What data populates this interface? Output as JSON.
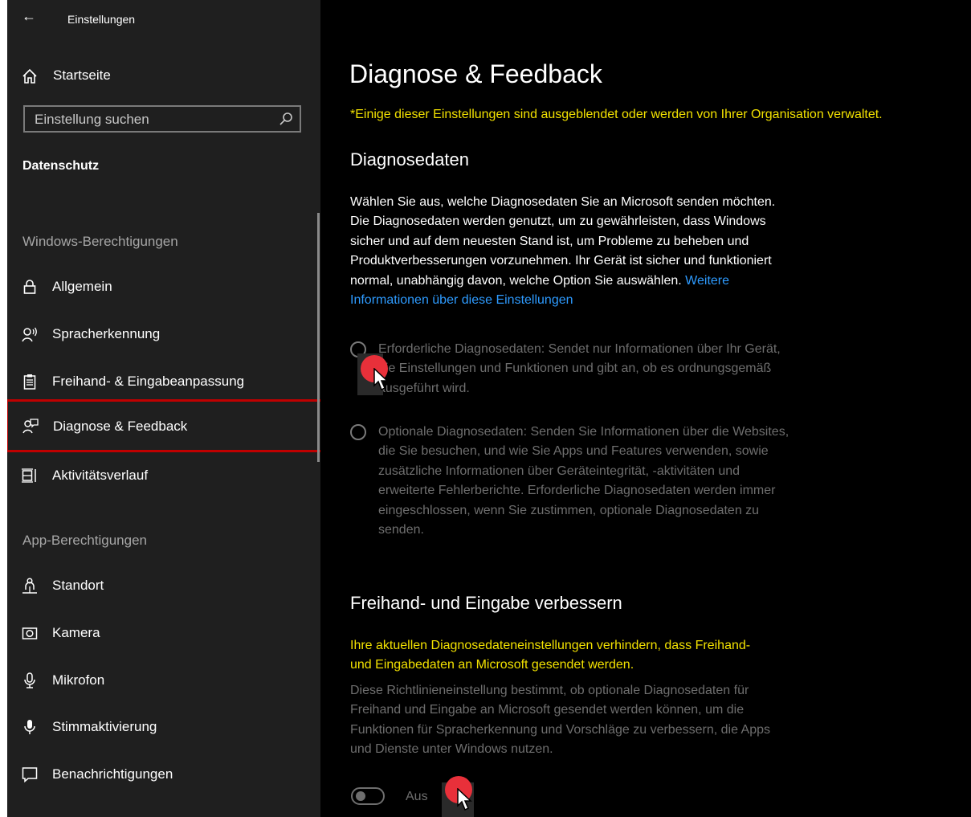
{
  "window": {
    "title": "Einstellungen",
    "back_glyph": "←"
  },
  "sidebar": {
    "home_label": "Startseite",
    "search_placeholder": "Einstellung suchen",
    "section_title": "Datenschutz",
    "group_windows": "Windows-Berechtigungen",
    "group_apps": "App-Berechtigungen",
    "windows_items": [
      {
        "label": "Allgemein",
        "icon": "lock-icon"
      },
      {
        "label": "Spracherkennung",
        "icon": "speech-icon"
      },
      {
        "label": "Freihand- & Eingabeanpassung",
        "icon": "clipboard-icon"
      },
      {
        "label": "Diagnose & Feedback",
        "icon": "feedback-icon",
        "selected": true
      },
      {
        "label": "Aktivitätsverlauf",
        "icon": "timeline-icon"
      }
    ],
    "app_items": [
      {
        "label": "Standort",
        "icon": "location-person-icon"
      },
      {
        "label": "Kamera",
        "icon": "camera-icon"
      },
      {
        "label": "Mikrofon",
        "icon": "microphone-icon"
      },
      {
        "label": "Stimmaktivierung",
        "icon": "voice-activation-icon"
      },
      {
        "label": "Benachrichtigungen",
        "icon": "notification-icon"
      }
    ]
  },
  "main": {
    "title": "Diagnose & Feedback",
    "org_note": "*Einige dieser Einstellungen sind ausgeblendet oder werden von Ihrer Organisation verwaltet.",
    "diagnostics": {
      "heading": "Diagnosedaten",
      "description": "Wählen Sie aus, welche Diagnosedaten Sie an Microsoft senden möchten. Die Diagnosedaten werden genutzt, um zu gewährleisten, dass Windows sicher und auf dem neuesten Stand ist, um Probleme zu beheben und Produktverbesserungen vorzunehmen. Ihr Gerät ist sicher und funktioniert normal, unabhängig davon, welche Option Sie auswählen.",
      "link": "Weitere Informationen über diese Einstellungen",
      "options": [
        {
          "label": "Erforderliche Diagnosedaten: Sendet nur Informationen über Ihr Gerät, die Einstellungen und Funktionen und gibt an, ob es ordnungsgemäß ausgeführt wird.",
          "selected": false
        },
        {
          "label": "Optionale Diagnosedaten: Senden Sie Informationen über die Websites, die Sie besuchen, und wie Sie Apps und Features verwenden, sowie zusätzliche Informationen über Geräteintegrität, -aktivitäten und erweiterte Fehlerberichte. Erforderliche Diagnosedaten werden immer eingeschlossen, wenn Sie zustimmen, optionale Diagnosedaten zu senden.",
          "selected": false
        }
      ]
    },
    "inking": {
      "heading": "Freihand- und Eingabe verbessern",
      "warning": "Ihre aktuellen Diagnosedateneinstellungen verhindern, dass Freihand- und Eingabedaten an Microsoft gesendet werden.",
      "policy": "Diese Richtlinieneinstellung bestimmt, ob optionale Diagnosedaten für Freihand und Eingabe an Microsoft gesendet werden können, um die Funktionen für Spracherkennung und Vorschläge zu verbessern, die Apps und Dienste unter Windows nutzen.",
      "toggle_label": "Aus",
      "toggle_on": false
    }
  },
  "colors": {
    "accent_link": "#2e9bff",
    "warning": "#f2e100",
    "selection_border": "#c00000",
    "cursor_dot": "#e8303a"
  }
}
